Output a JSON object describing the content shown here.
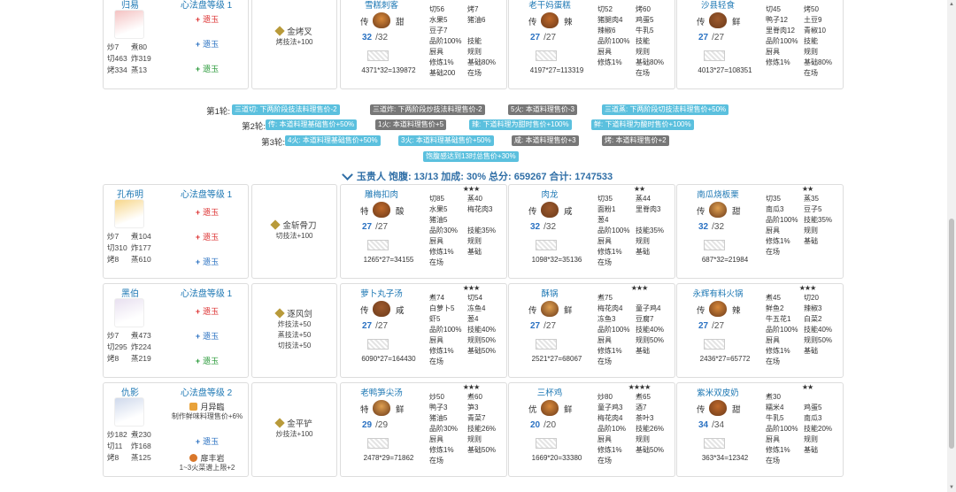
{
  "top_partial": {
    "chef_name": "归易",
    "chef_level": "心法盘等级 1",
    "stats": [
      "炒7",
      "煮80",
      "切463",
      "炸319",
      "烤334",
      "蒸13"
    ],
    "yu": [
      {
        "sym": "+",
        "label": "遗玉",
        "cls": "r"
      },
      {
        "sym": "+",
        "label": "遗玉",
        "cls": "b"
      },
      {
        "sym": "+",
        "label": "遗玉",
        "cls": "g"
      }
    ],
    "tool_name": "金烤叉",
    "tool_desc": "烤技法+100",
    "dishes": [
      {
        "name": "雪糕刺客",
        "mode": "传",
        "taste": "甜",
        "count": "32",
        "max": "/32",
        "formula": "4371*32=139872",
        "grid": [
          [
            "切56",
            "烤7"
          ],
          [
            "水果5",
            "猪油6"
          ],
          [
            "豆子7",
            ""
          ],
          [
            "品阶100%",
            "技能"
          ],
          [
            "厨具",
            "规则"
          ],
          [
            "修炼1%",
            "基础80%"
          ],
          [
            "基础200",
            "在场"
          ]
        ]
      },
      {
        "name": "老干妈蛋糕",
        "mode": "传",
        "taste": "辣",
        "count": "27",
        "max": "/27",
        "formula": "4197*27=113319",
        "grid": [
          [
            "切52",
            "烤60"
          ],
          [
            "猪腿肉4",
            "鸡蛋5"
          ],
          [
            "辣椒6",
            "牛乳5"
          ],
          [
            "品阶100%",
            "技能"
          ],
          [
            "厨具",
            "规则"
          ],
          [
            "修炼1%",
            "基础80%"
          ],
          [
            "",
            "在场"
          ]
        ]
      },
      {
        "name": "沙县轻食",
        "mode": "传",
        "taste": "鲜",
        "count": "27",
        "max": "/27",
        "formula": "4013*27=108351",
        "grid": [
          [
            "切45",
            "烤50"
          ],
          [
            "鸭子12",
            "土豆9"
          ],
          [
            "里脊肉12",
            "青椒10"
          ],
          [
            "品阶100%",
            "技能"
          ],
          [
            "厨具",
            "规则"
          ],
          [
            "修炼1%",
            "基础80%"
          ],
          [
            "",
            "在场"
          ]
        ]
      }
    ]
  },
  "rounds": [
    {
      "label": "第1轮:",
      "tags": [
        {
          "text": "三道切: 下两阶段技法料理售价-2",
          "cls": "tb"
        },
        {
          "text": "三道炸: 下两阶段炒技法料理售价-2",
          "cls": "tg"
        },
        {
          "text": "5火: 本道料理售价-3",
          "cls": "tg"
        },
        {
          "text": "三道蒸: 下两阶段切技法料理售价+50%",
          "cls": "tb"
        }
      ]
    },
    {
      "label": "第2轮:",
      "tags": [
        {
          "text": "传: 本道料理基础售价+50%",
          "cls": "tb"
        },
        {
          "text": "1火: 本道料理售价+5",
          "cls": "tg"
        },
        {
          "text": "辣: 下道料理为甜时售价+100%",
          "cls": "tb"
        },
        {
          "text": "鲜: 下道料理为酸时售价+100%",
          "cls": "tb"
        }
      ]
    },
    {
      "label": "第3轮:",
      "tags": [
        {
          "text": "4火: 本道料理基础售价+50%",
          "cls": "tb"
        },
        {
          "text": "3火: 本道料理基础售价+50%",
          "cls": "tb"
        },
        {
          "text": "咸: 本道料理售价+3",
          "cls": "tg"
        },
        {
          "text": "烤: 本道料理售价+2",
          "cls": "tg"
        }
      ]
    },
    {
      "label": "",
      "tags": [
        {
          "text": "饱腹感达到13时总售价+30%",
          "cls": "tb"
        }
      ]
    }
  ],
  "summary": "玉贵人 饱腹: 13/13 加成: 30% 总分: 659267 合计: 1747533",
  "rows": [
    {
      "chef_name": "孔布明",
      "chef_level": "心法盘等级 1",
      "stats": [
        "炒7",
        "煮104",
        "切310",
        "炸177",
        "烤8",
        "蒸610"
      ],
      "yu": [
        {
          "sym": "+",
          "label": "遗玉",
          "cls": "r"
        },
        {
          "sym": "+",
          "label": "遗玉",
          "cls": "r"
        },
        {
          "sym": "+",
          "label": "遗玉",
          "cls": "b"
        }
      ],
      "extra": [],
      "tool_name": "金斩骨刀",
      "tool_desc": [
        "切技法+100"
      ],
      "dishes": [
        {
          "name": "雕梅扣肉",
          "rarity": "★★★",
          "mode": "特",
          "taste": "酸",
          "count": "27",
          "max": "/27",
          "formula": "1265*27=34155",
          "grid": [
            [
              "切85",
              "蒸40"
            ],
            [
              "水果5",
              "梅花肉3"
            ],
            [
              "猪油5",
              ""
            ],
            [
              "品阶30%",
              "技能35%"
            ],
            [
              "厨具",
              "规则"
            ],
            [
              "修炼1%",
              "基础"
            ],
            [
              "在场",
              ""
            ]
          ]
        },
        {
          "name": "肉龙",
          "rarity": "★★",
          "mode": "传",
          "taste": "咸",
          "count": "32",
          "max": "/32",
          "formula": "1098*32=35136",
          "grid": [
            [
              "切35",
              "蒸44"
            ],
            [
              "面粉1",
              "里脊肉3"
            ],
            [
              "葱4",
              ""
            ],
            [
              "品阶100%",
              "技能35%"
            ],
            [
              "厨具",
              "规则"
            ],
            [
              "修炼1%",
              "基础"
            ],
            [
              "在场",
              ""
            ]
          ]
        },
        {
          "name": "南瓜烧板栗",
          "rarity": "★★",
          "mode": "传",
          "taste": "甜",
          "count": "32",
          "max": "/32",
          "formula": "687*32=21984",
          "grid": [
            [
              "切35",
              "蒸35"
            ],
            [
              "南瓜3",
              "豆子5"
            ],
            [
              "",
              ""
            ],
            [
              "品阶100%",
              "技能35%"
            ],
            [
              "厨具",
              "规则"
            ],
            [
              "修炼1%",
              "基础"
            ],
            [
              "在场",
              ""
            ]
          ]
        }
      ]
    },
    {
      "chef_name": "黑伯",
      "chef_level": "心法盘等级 1",
      "stats": [
        "炒7",
        "煮473",
        "切295",
        "炸224",
        "烤8",
        "蒸219"
      ],
      "yu": [
        {
          "sym": "+",
          "label": "遗玉",
          "cls": "r"
        },
        {
          "sym": "+",
          "label": "遗玉",
          "cls": "b"
        },
        {
          "sym": "+",
          "label": "遗玉",
          "cls": "g"
        }
      ],
      "extra": [],
      "tool_name": "逐风剑",
      "tool_desc": [
        "炸技法+50",
        "蒸技法+50",
        "切技法+50"
      ],
      "dishes": [
        {
          "name": "萝卜丸子汤",
          "rarity": "★★★",
          "mode": "传",
          "taste": "咸",
          "count": "27",
          "max": "/27",
          "formula": "6090*27=164430",
          "grid": [
            [
              "煮74",
              "切54"
            ],
            [
              "白萝卜5",
              "冻鱼4"
            ],
            [
              "虾5",
              "葱4"
            ],
            [
              "品阶100%",
              "技能40%"
            ],
            [
              "厨具",
              "规则50%"
            ],
            [
              "修炼1%",
              "基础50%"
            ],
            [
              "在场",
              ""
            ]
          ]
        },
        {
          "name": "酥锅",
          "rarity": "★★★",
          "mode": "传",
          "taste": "鲜",
          "count": "27",
          "max": "/27",
          "formula": "2521*27=68067",
          "grid": [
            [
              "煮75",
              ""
            ],
            [
              "梅花肉4",
              "童子鸡4"
            ],
            [
              "冻鱼3",
              "豆腐7"
            ],
            [
              "品阶100%",
              "技能40%"
            ],
            [
              "厨具",
              "规则50%"
            ],
            [
              "修炼1%",
              "基础"
            ],
            [
              "在场",
              ""
            ]
          ]
        },
        {
          "name": "永辉有料火锅",
          "rarity": "★★★",
          "mode": "传",
          "taste": "辣",
          "count": "27",
          "max": "/27",
          "formula": "2436*27=65772",
          "grid": [
            [
              "煮45",
              "切20"
            ],
            [
              "鲜鱼2",
              "辣椒3"
            ],
            [
              "牛五花1",
              "白菜2"
            ],
            [
              "品阶100%",
              "技能40%"
            ],
            [
              "厨具",
              "规则50%"
            ],
            [
              "修炼1%",
              "基础"
            ],
            [
              "在场",
              ""
            ]
          ]
        }
      ]
    },
    {
      "chef_name": "仇影",
      "chef_level": "心法盘等级 2",
      "stats": [
        "炒182",
        "煮230",
        "切11",
        "炸168",
        "烤8",
        "蒸125"
      ],
      "yu": [
        {
          "sym": "+",
          "label": "遗玉",
          "cls": "b"
        }
      ],
      "extra": [
        {
          "name": "月异臨",
          "desc": "制作鲜味料理售价+6%"
        },
        {
          "name": "扉丰岩",
          "desc": "1~3火菜谱上限+2"
        }
      ],
      "tool_name": "金平铲",
      "tool_desc": [
        "炒技法+100"
      ],
      "dishes": [
        {
          "name": "老鸭笋尖汤",
          "rarity": "★★★",
          "mode": "特",
          "taste": "鲜",
          "count": "29",
          "max": "/29",
          "formula": "2478*29=71862",
          "grid": [
            [
              "炒50",
              "煮60"
            ],
            [
              "鸭子3",
              "笋3"
            ],
            [
              "猪油5",
              "青菜7"
            ],
            [
              "品阶30%",
              "技能26%"
            ],
            [
              "厨具",
              "规则"
            ],
            [
              "修炼1%",
              "基础50%"
            ],
            [
              "在场",
              ""
            ]
          ]
        },
        {
          "name": "三杯鸡",
          "rarity": "★★★★",
          "mode": "优",
          "taste": "鲜",
          "count": "20",
          "max": "/20",
          "formula": "1669*20=33380",
          "grid": [
            [
              "炒80",
              "煮65"
            ],
            [
              "童子鸡3",
              "酒7"
            ],
            [
              "梅花肉4",
              "茶叶3"
            ],
            [
              "品阶10%",
              "技能26%"
            ],
            [
              "厨具",
              "规则"
            ],
            [
              "修炼1%",
              "基础50%"
            ],
            [
              "在场",
              ""
            ]
          ]
        },
        {
          "name": "紫米双皮奶",
          "rarity": "★★",
          "mode": "传",
          "taste": "甜",
          "count": "34",
          "max": "/34",
          "formula": "363*34=12342",
          "grid": [
            [
              "煮30",
              ""
            ],
            [
              "糯米4",
              "鸡蛋5"
            ],
            [
              "牛乳5",
              "南瓜3"
            ],
            [
              "品阶100%",
              "技能20%"
            ],
            [
              "厨具",
              "规则"
            ],
            [
              "修炼1%",
              "基础"
            ],
            [
              "在场",
              ""
            ]
          ]
        }
      ]
    }
  ]
}
